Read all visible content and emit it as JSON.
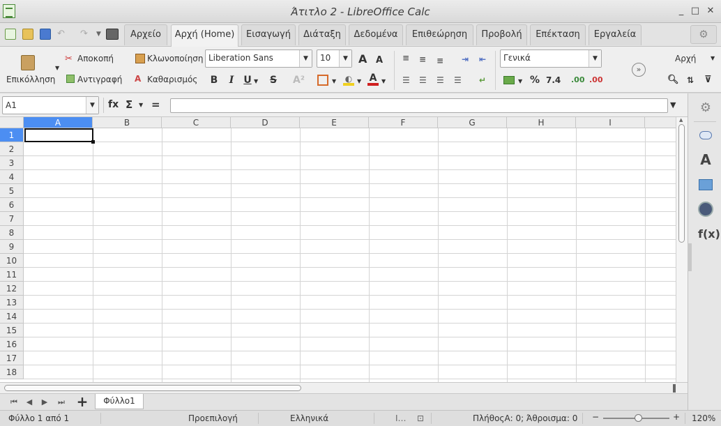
{
  "window": {
    "title": "Άτιτλο 2 - LibreOffice Calc",
    "controls": {
      "minimize": "_",
      "maximize": "□",
      "close": "✕"
    }
  },
  "menu_tabs": [
    {
      "label": "Αρχείο",
      "active": false
    },
    {
      "label": "Αρχή (Home)",
      "active": true
    },
    {
      "label": "Εισαγωγή",
      "active": false
    },
    {
      "label": "Διάταξη",
      "active": false
    },
    {
      "label": "Δεδομένα",
      "active": false
    },
    {
      "label": "Επιθεώρηση",
      "active": false
    },
    {
      "label": "Προβολή",
      "active": false
    },
    {
      "label": "Επέκταση",
      "active": false
    },
    {
      "label": "Εργαλεία",
      "active": false
    }
  ],
  "ribbon": {
    "paste_label": "Επικόλληση",
    "cut_label": "Αποκοπή",
    "copy_label": "Αντιγραφή",
    "clone_label": "Κλωνοποίηση",
    "clear_label": "Καθαρισμός",
    "font_name": "Liberation Sans",
    "font_size": "10",
    "number_format": "Γενικά",
    "styles_label": "Αρχή",
    "bold": "B",
    "italic": "I",
    "underline": "U",
    "strike": "S",
    "percent": "%",
    "decimal": "7.4",
    "grow_font": "A",
    "shrink_font": "A"
  },
  "formula_bar": {
    "name_box": "A1",
    "fx": "fx",
    "sigma": "Σ",
    "equals": "=",
    "content": ""
  },
  "sheet": {
    "columns": [
      "A",
      "B",
      "C",
      "D",
      "E",
      "F",
      "G",
      "H",
      "I"
    ],
    "rows": [
      "1",
      "2",
      "3",
      "4",
      "5",
      "6",
      "7",
      "8",
      "9",
      "10",
      "11",
      "12",
      "13",
      "14",
      "15",
      "16",
      "17",
      "18"
    ],
    "selected_cell": "A1"
  },
  "sheet_tabs": {
    "tabs": [
      "Φύλλο1"
    ],
    "add_label": "+"
  },
  "status_bar": {
    "sheet_position": "Φύλλο 1 από 1",
    "page_style": "Προεπιλογή",
    "language": "Ελληνικά",
    "summary": "ΠλήθοςΑ: 0; Άθροισμα: 0",
    "zoom": "120%",
    "zoom_minus": "−",
    "zoom_plus": "+"
  },
  "colors": {
    "selection_header": "#4c8ef2",
    "grid": "#d4d4d4",
    "chrome": "#efefef"
  }
}
